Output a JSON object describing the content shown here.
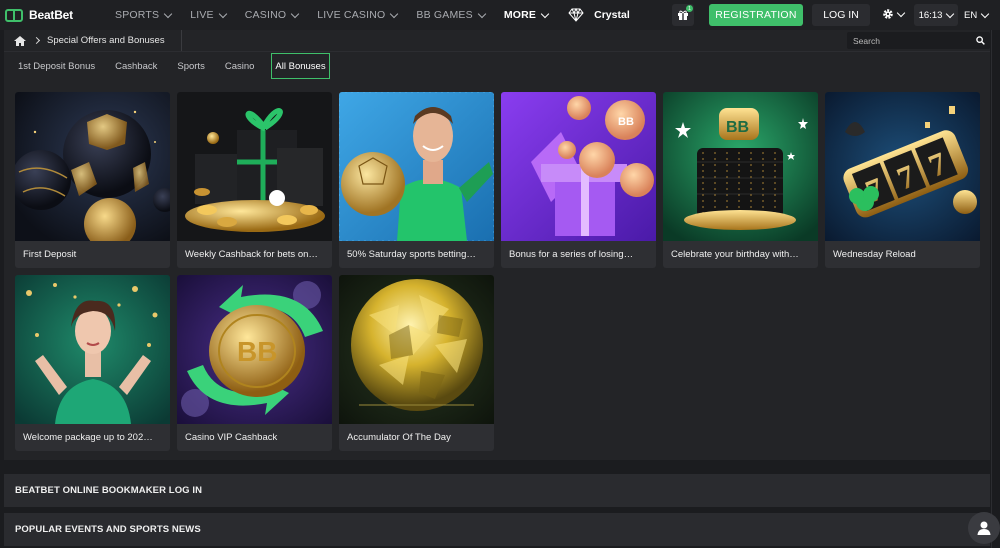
{
  "brand": {
    "name": "BeatBet",
    "accent": "#3fbf6a"
  },
  "nav": {
    "items": [
      {
        "label": "SPORTS",
        "dropdown": true
      },
      {
        "label": "LIVE",
        "dropdown": true
      },
      {
        "label": "CASINO",
        "dropdown": true
      },
      {
        "label": "LIVE CASINO",
        "dropdown": true
      },
      {
        "label": "BB GAMES",
        "dropdown": true
      },
      {
        "label": "MORE",
        "dropdown": true
      }
    ],
    "crystal_label": "Crystal"
  },
  "header": {
    "gift_badge": "1",
    "registration_label": "REGISTRATION",
    "login_label": "LOG IN",
    "time": "16:13",
    "language": "EN"
  },
  "breadcrumb": {
    "current": "Special Offers and Bonuses"
  },
  "search": {
    "placeholder": "Search"
  },
  "tabs": [
    {
      "label": "1st Deposit Bonus",
      "active": false
    },
    {
      "label": "Cashback",
      "active": false
    },
    {
      "label": "Sports",
      "active": false
    },
    {
      "label": "Casino",
      "active": false
    },
    {
      "label": "All Bonuses",
      "active": true
    }
  ],
  "bonuses": [
    {
      "title": "First Deposit",
      "image": "black-gold-balls-image"
    },
    {
      "title": "Weekly Cashback for bets on…",
      "image": "gift-box-coins-image"
    },
    {
      "title": "50% Saturday sports betting…",
      "image": "goalkeeper-ball-image"
    },
    {
      "title": "Bonus for a series of losing…",
      "image": "purple-gift-coins-image"
    },
    {
      "title": "Celebrate your birthday with…",
      "image": "birthday-cake-image"
    },
    {
      "title": "Wednesday Reload",
      "image": "slot-reels-777-image"
    },
    {
      "title": "Welcome package up to 202…",
      "image": "woman-confetti-image"
    },
    {
      "title": "Casino VIP Cashback",
      "image": "gold-coin-arrows-image"
    },
    {
      "title": "Accumulator Of The Day",
      "image": "disco-ball-image"
    }
  ],
  "footer": {
    "login_section": "BEATBET ONLINE BOOKMAKER LOG IN",
    "news_section": "POPULAR EVENTS AND SPORTS NEWS"
  }
}
